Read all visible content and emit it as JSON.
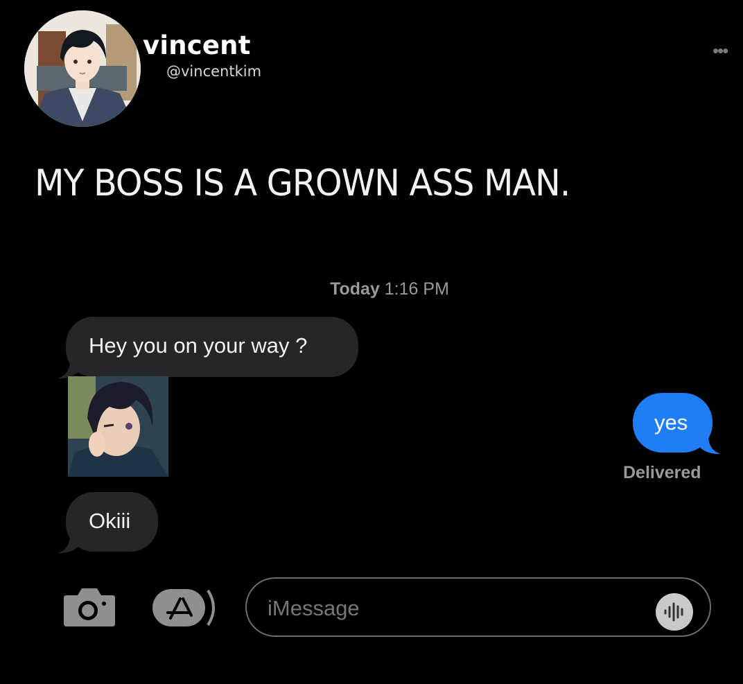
{
  "profile": {
    "display_name": "vincent",
    "handle": "@vincentkim",
    "more_icon": "more-horizontal-icon"
  },
  "post": {
    "text": "MY BOSS IS A GROWN ASS MAN."
  },
  "conversation": {
    "timestamp_day": "Today",
    "timestamp_time": "1:16 PM",
    "messages": [
      {
        "direction": "received",
        "text": "Hey you on your way ?"
      },
      {
        "direction": "received",
        "type": "image"
      },
      {
        "direction": "sent",
        "text": "yes"
      },
      {
        "direction": "received",
        "text": "Okiii"
      }
    ],
    "status": "Delivered"
  },
  "composer": {
    "placeholder": "iMessage",
    "camera_icon": "camera-icon",
    "apps_icon": "app-store-icon",
    "audio_icon": "audio-waveform-icon"
  },
  "colors": {
    "background": "#000000",
    "received_bubble": "#262628",
    "sent_bubble": "#1f7ef5",
    "meta_text": "#9a9a9a"
  }
}
